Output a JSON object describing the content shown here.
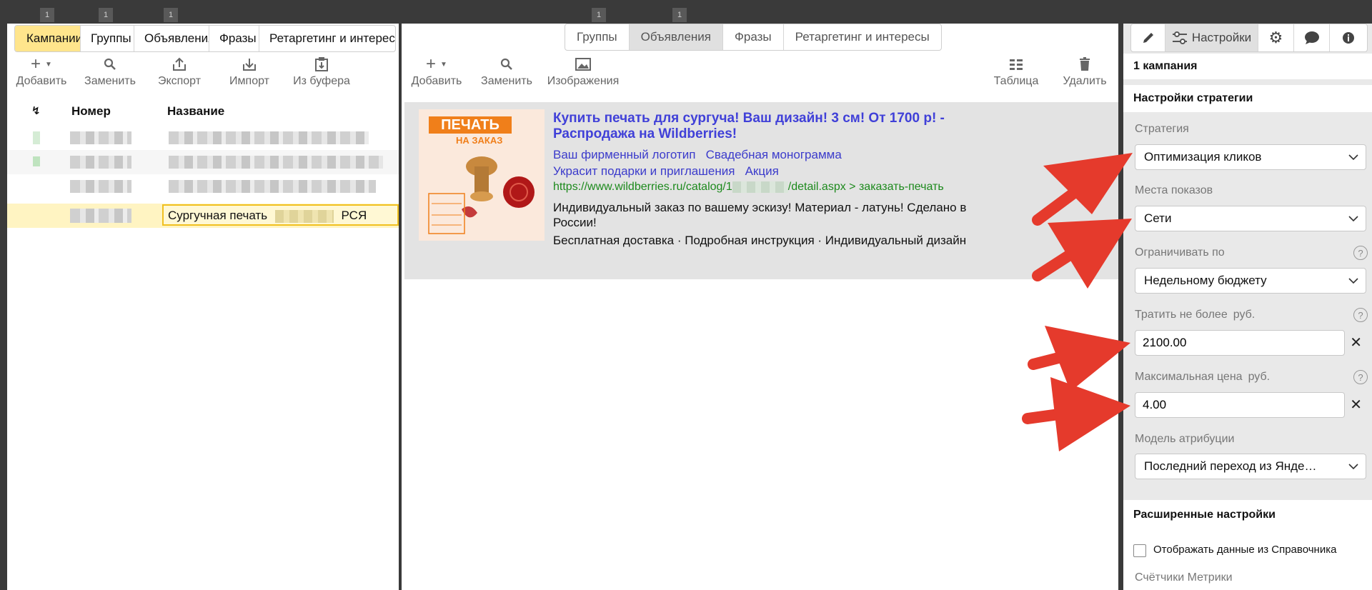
{
  "badges": {
    "left": [
      "1",
      "1",
      "1"
    ],
    "mid": [
      "1",
      "1"
    ]
  },
  "left": {
    "tabs": [
      {
        "label": "Кампании",
        "active": true
      },
      {
        "label": "Группы",
        "active": false
      },
      {
        "label": "Объявления",
        "active": false
      },
      {
        "label": "Фразы",
        "active": false
      },
      {
        "label": "Ретаргетинг и интересы",
        "active": false
      }
    ],
    "toolbar": {
      "add": "Добавить",
      "replace": "Заменить",
      "export": "Экспорт",
      "import": "Импорт",
      "from_buffer": "Из буфера"
    },
    "columns": {
      "number": "Номер",
      "name": "Название"
    },
    "selected_row": {
      "name_start": "Сургучная печать",
      "name_end": "РСЯ"
    }
  },
  "mid": {
    "tabs": [
      {
        "label": "Группы",
        "active": false
      },
      {
        "label": "Объявления",
        "active": true
      },
      {
        "label": "Фразы",
        "active": false
      },
      {
        "label": "Ретаргетинг и интересы",
        "active": false
      }
    ],
    "toolbar": {
      "add": "Добавить",
      "replace": "Заменить",
      "images": "Изображения",
      "table": "Таблица",
      "delete": "Удалить"
    },
    "ad": {
      "image_text_1": "ПЕЧАТЬ",
      "image_text_2": "НА ЗАКАЗ",
      "title": "Купить печать для сургуча! Ваш дизайн! 3 см! От 1700 р! - Распродажа на Wildberries!",
      "sitelinks": [
        "Ваш фирменный логотип",
        "Свадебная монограмма",
        "Украсит подарки и приглашения",
        "Акция"
      ],
      "url_start": "https://www.wildberries.ru/catalog/1",
      "url_end": "/detail.aspx > заказать-печать",
      "text": "Индивидуальный заказ по вашему эскизу! Материал - латунь! Сделано в России!",
      "extensions": "Бесплатная доставка · Подробная инструкция · Индивидуальный дизайн"
    }
  },
  "right": {
    "settings_tab": "Настройки",
    "campaign_count": "1 кампания",
    "strategy_section": "Настройки стратегии",
    "strategy": {
      "label": "Стратегия",
      "value": "Оптимизация кликов"
    },
    "placement": {
      "label": "Места показов",
      "value": "Сети"
    },
    "limit": {
      "label": "Ограничивать по",
      "value": "Недельному бюджету"
    },
    "spend": {
      "label": "Тратить не более",
      "unit": "руб.",
      "value": "2100.00"
    },
    "max_price": {
      "label": "Максимальная цена",
      "unit": "руб.",
      "value": "4.00"
    },
    "attribution": {
      "label": "Модель атрибуции",
      "value": "Последний переход из Янде…"
    },
    "advanced_section": "Расширенные настройки",
    "show_directory": {
      "label": "Отображать данные из Справочника",
      "checked": false
    },
    "metrica_label": "Счётчики Метрики"
  },
  "colors": {
    "accent_arrow": "#e53a2c",
    "active_tab": "#ffe58c",
    "link": "#4040d8",
    "url": "#1d8a1d"
  }
}
